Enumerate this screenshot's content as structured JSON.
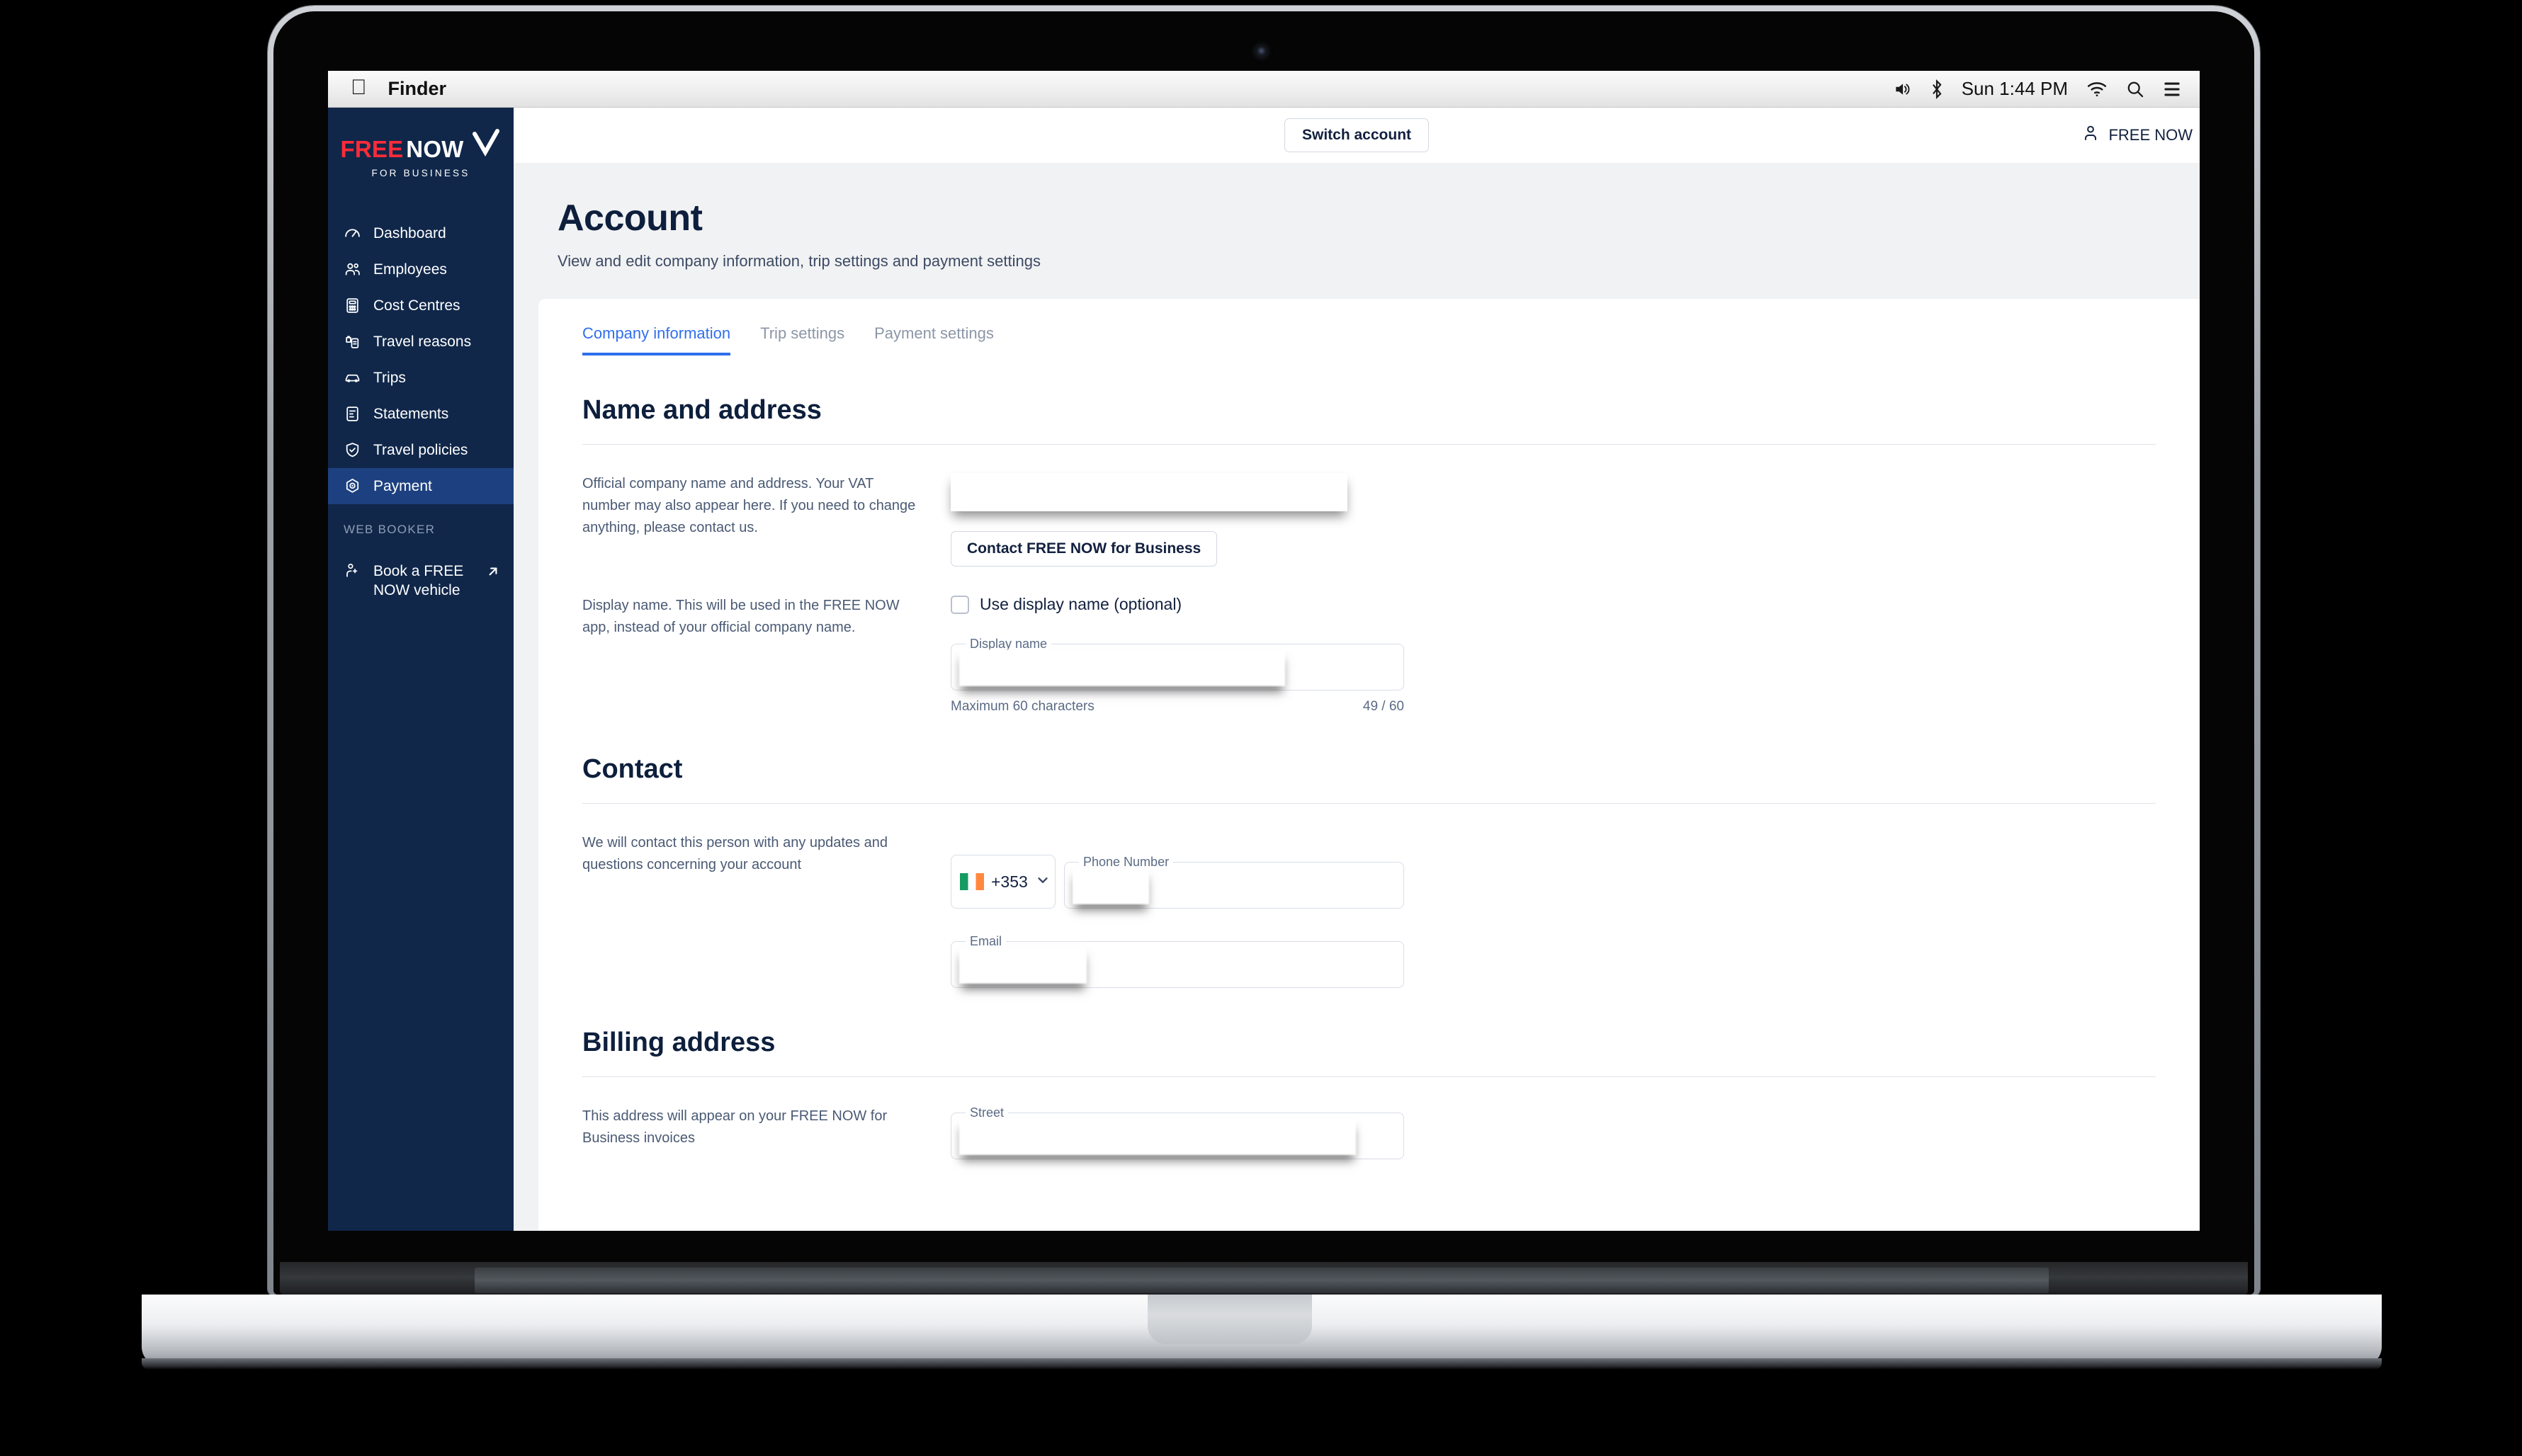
{
  "os": {
    "apple_logo": "apple-logo",
    "active_app": "Finder",
    "menu_right": {
      "volume_icon": "volume-icon",
      "bluetooth_icon": "bluetooth-icon",
      "clock": "Sun 1:44 PM",
      "wifi_icon": "wifi-icon",
      "search_icon": "search-icon",
      "control_center_icon": "control-center-icon"
    }
  },
  "sidebar": {
    "logo": {
      "free": "FREE",
      "now": "NOW",
      "tagline": "FOR BUSINESS"
    },
    "items": [
      {
        "label": "Dashboard",
        "icon": "dashboard-icon",
        "active": false
      },
      {
        "label": "Employees",
        "icon": "employees-icon",
        "active": false
      },
      {
        "label": "Cost Centres",
        "icon": "cost-centres-icon",
        "active": false
      },
      {
        "label": "Travel reasons",
        "icon": "travel-reasons-icon",
        "active": false
      },
      {
        "label": "Trips",
        "icon": "trips-icon",
        "active": false
      },
      {
        "label": "Statements",
        "icon": "statements-icon",
        "active": false
      },
      {
        "label": "Travel policies",
        "icon": "travel-policies-icon",
        "active": false
      },
      {
        "label": "Payment",
        "icon": "payment-icon",
        "active": true
      }
    ],
    "section_label": "WEB BOOKER",
    "external": {
      "label": "Book a FREE NOW vehicle",
      "icon": "book-vehicle-icon",
      "arrow": "external-link-arrow"
    }
  },
  "topbar": {
    "switch_account_label": "Switch account",
    "user_name": "FREE NOW",
    "user_icon": "person-icon"
  },
  "page": {
    "title": "Account",
    "subtitle": "View and edit company information, trip settings and payment settings"
  },
  "tabs": [
    {
      "label": "Company information",
      "active": true
    },
    {
      "label": "Trip settings",
      "active": false
    },
    {
      "label": "Payment settings",
      "active": false
    }
  ],
  "sections": {
    "name_address": {
      "title": "Name and address",
      "desc": "Official company name and address. Your VAT number may also appear here. If you need to change anything, please contact us.",
      "company_value": "",
      "contact_button": "Contact FREE NOW for Business",
      "display_desc": "Display name. This will be used in the FREE NOW app, instead of your official company name.",
      "checkbox_label": "Use display name (optional)",
      "checkbox_checked": false,
      "display_field_label": "Display name",
      "display_field_value": "",
      "helper_left": "Maximum 60 characters",
      "helper_right": "49 / 60"
    },
    "contact": {
      "title": "Contact",
      "desc": "We will contact this person with any updates and questions concerning your account",
      "country_code": "+353",
      "country_flag": "flag-ireland",
      "chevron_icon": "chevron-down-icon",
      "phone_label": "Phone Number",
      "phone_value": "",
      "email_label": "Email",
      "email_value": ""
    },
    "billing": {
      "title": "Billing address",
      "desc": "This address will appear on your FREE NOW for Business invoices",
      "street_label": "Street",
      "street_value": ""
    }
  },
  "colors": {
    "sidebar_bg": "#10274a",
    "sidebar_active": "#1d4180",
    "brand_red": "#ff2b38",
    "accent_blue": "#2f6fed",
    "page_bg": "#f1f2f4",
    "heading": "#0d1f3c"
  }
}
